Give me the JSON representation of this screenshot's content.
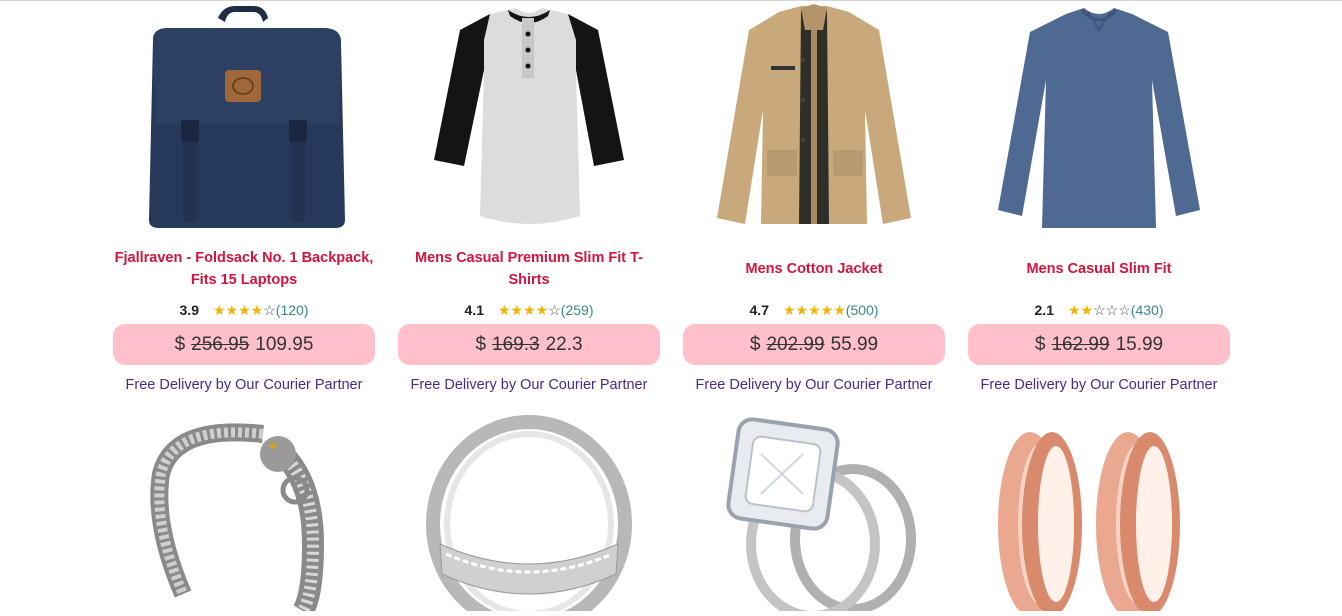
{
  "products": [
    {
      "title": "Fjallraven - Foldsack No. 1 Backpack, Fits 15 Laptops",
      "title_line1": "Fjallraven - Foldsack No. 1 Backpack,",
      "title_line2": "Fits 15 Laptops",
      "rating": "3.9",
      "filled_stars": 4,
      "rating_count": "(120)",
      "currency": "$",
      "old_price": "256.95",
      "new_price": "109.95",
      "delivery": "Free Delivery by Our Courier Partner",
      "image": "backpack"
    },
    {
      "title": "Mens Casual Premium Slim Fit T-Shirts",
      "title_line1": "Mens Casual Premium Slim Fit T-",
      "title_line2": "Shirts",
      "rating": "4.1",
      "filled_stars": 4,
      "rating_count": "(259)",
      "currency": "$",
      "old_price": "169.3",
      "new_price": "22.3",
      "delivery": "Free Delivery by Our Courier Partner",
      "image": "raglan-tshirt"
    },
    {
      "title": "Mens Cotton Jacket",
      "title_line1": "Mens Cotton Jacket",
      "title_line2": "",
      "rating": "4.7",
      "filled_stars": 5,
      "rating_count": "(500)",
      "currency": "$",
      "old_price": "202.99",
      "new_price": "55.99",
      "delivery": "Free Delivery by Our Courier Partner",
      "image": "cotton-jacket"
    },
    {
      "title": "Mens Casual Slim Fit",
      "title_line1": "Mens Casual Slim Fit",
      "title_line2": "",
      "rating": "2.1",
      "filled_stars": 2,
      "rating_count": "(430)",
      "currency": "$",
      "old_price": "162.99",
      "new_price": "15.99",
      "delivery": "Free Delivery by Our Courier Partner",
      "image": "long-sleeve-shirt"
    }
  ],
  "second_row_images": [
    "dragon-bracelet",
    "silver-ring",
    "diamond-ring-set",
    "rose-gold-plugs"
  ],
  "colors": {
    "title": "#d4143c",
    "price_pill": "#ffc0cb",
    "delivery_text": "#4b2a8a",
    "star": "#f5b301",
    "rating_count": "#3a8a8a"
  }
}
